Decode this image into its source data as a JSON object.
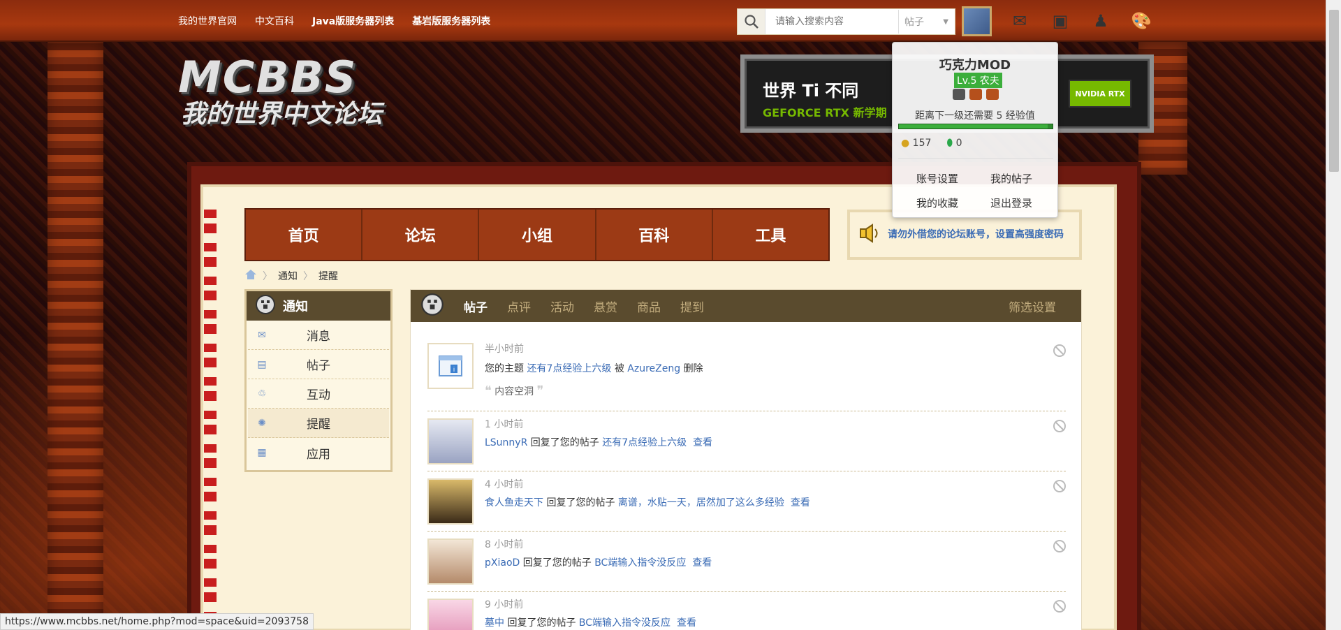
{
  "toplinks": [
    "我的世界官网",
    "中文百科",
    "Java版服务器列表",
    "基岩版服务器列表"
  ],
  "search": {
    "placeholder": "请输入搜索内容",
    "type": "帖子"
  },
  "logo": {
    "mc": "MCBBS",
    "zh": "我的世界中文论坛"
  },
  "banner": {
    "line1": "世界 Ti 不同",
    "line2": "GEFORCE RTX 新学期",
    "badge": "NVIDIA RTX"
  },
  "mainnav": [
    "首页",
    "论坛",
    "小组",
    "百科",
    "工具"
  ],
  "notice": "请勿外借您的论坛账号，设置高强度密码",
  "breadcrumb": [
    "通知",
    "提醒"
  ],
  "sidebar": {
    "title": "通知",
    "items": [
      {
        "label": "消息",
        "icon": "envelope-icon"
      },
      {
        "label": "帖子",
        "icon": "document-icon"
      },
      {
        "label": "互动",
        "icon": "recycle-icon"
      },
      {
        "label": "提醒",
        "icon": "bell-icon"
      },
      {
        "label": "应用",
        "icon": "grid-icon"
      }
    ]
  },
  "tabs": [
    "帖子",
    "点评",
    "活动",
    "悬赏",
    "商品",
    "提到"
  ],
  "filter_label": "筛选设置",
  "notifications": [
    {
      "time": "半小时前",
      "prefix": "您的主题",
      "link": "还有7点经验上六级",
      "mid": "被",
      "user": "AzureZeng",
      "action": "删除",
      "quote_open": "❝",
      "quote": "内容空洞",
      "quote_close": "❞"
    },
    {
      "time": "1 小时前",
      "user": "LSunnyR",
      "action": "回复了您的帖子",
      "link": "还有7点经验上六级",
      "view": "查看"
    },
    {
      "time": "4 小时前",
      "user": "食人鱼走天下",
      "action": "回复了您的帖子",
      "link": "离谱，水贴一天，居然加了这么多经验",
      "view": "查看"
    },
    {
      "time": "8 小时前",
      "user": "pXiaoD",
      "action": "回复了您的帖子",
      "link": "BC端输入指令没反应",
      "view": "查看"
    },
    {
      "time": "9 小时前",
      "user": "墓中",
      "action": "回复了您的帖子",
      "link": "BC端输入指令没反应",
      "view": "查看"
    }
  ],
  "user": {
    "name": "巧克力MOD",
    "level": "Lv.5 农夫",
    "exp_text": "距离下一级还需要 5 经验值",
    "exp_progress": 0.97,
    "gold": "157",
    "emerald": "0",
    "menu": [
      "账号设置",
      "我的帖子",
      "我的收藏",
      "退出登录"
    ]
  },
  "status_url": "https://www.mcbbs.net/home.php?mod=space&uid=2093758",
  "colors": {
    "link": "#3a6bb5",
    "nav": "#9c3a15",
    "panel_head": "#5a4b2e",
    "level": "#3bae3b"
  }
}
